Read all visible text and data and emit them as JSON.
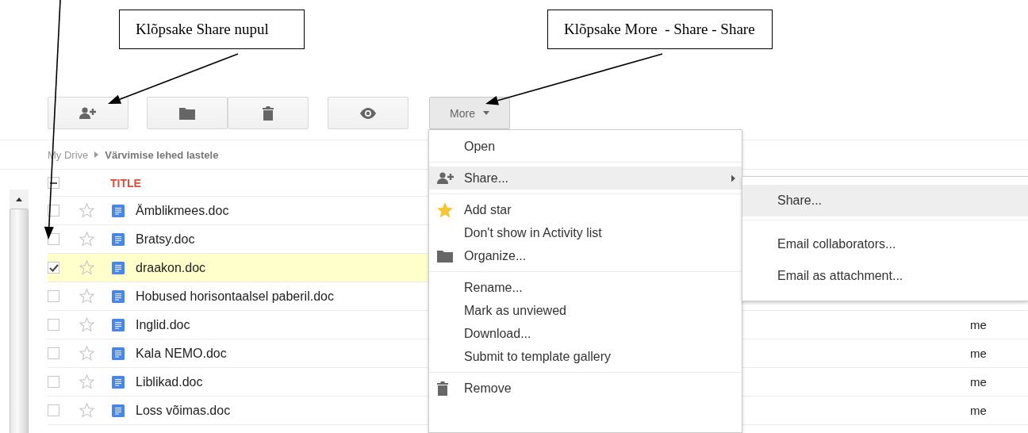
{
  "annotations": [
    {
      "text": "Klõpsake Share nupul"
    },
    {
      "text": "Klõpsake More  - Share - Share"
    }
  ],
  "toolbar": {
    "buttons": [
      {
        "kind": "share"
      },
      {
        "kind": "folder"
      },
      {
        "kind": "trash"
      },
      {
        "kind": "preview"
      },
      {
        "kind": "more",
        "label": "More"
      }
    ]
  },
  "breadcrumb": [
    "My Drive",
    "Värvimise lehed lastele"
  ],
  "table": {
    "select_all": {
      "indeterminate": true
    },
    "columns": [
      "TITLE"
    ],
    "rows": [
      {
        "name": "Ämblikmees.doc",
        "checked": false,
        "starred": false,
        "selected": false
      },
      {
        "name": "Bratsy.doc",
        "checked": false,
        "starred": false,
        "selected": false
      },
      {
        "name": "draakon.doc",
        "checked": true,
        "starred": false,
        "selected": true
      },
      {
        "name": "Hobused horisontaalsel paberil.doc",
        "checked": false,
        "starred": false,
        "selected": false
      },
      {
        "name": "Inglid.doc",
        "checked": false,
        "starred": false,
        "selected": false,
        "owner": "me"
      },
      {
        "name": "Kala NEMO.doc",
        "checked": false,
        "starred": false,
        "selected": false,
        "owner": "me"
      },
      {
        "name": "Liblikad.doc",
        "checked": false,
        "starred": false,
        "selected": false,
        "owner": "me"
      },
      {
        "name": "Loss võimas.doc",
        "checked": false,
        "starred": false,
        "selected": false,
        "owner": "me"
      }
    ]
  },
  "menu": {
    "items": [
      {
        "kind": "item",
        "label": "Open",
        "selected": false
      },
      {
        "kind": "separator"
      },
      {
        "kind": "share",
        "label": "Share...",
        "selected": true,
        "submenu": true
      },
      {
        "kind": "separator"
      },
      {
        "kind": "star",
        "label": "Add star",
        "selected": false
      },
      {
        "kind": "item",
        "label": "Don't show in Activity list",
        "selected": false
      },
      {
        "kind": "folder",
        "label": "Organize...",
        "selected": false
      },
      {
        "kind": "separator"
      },
      {
        "kind": "item",
        "label": "Rename...",
        "selected": false
      },
      {
        "kind": "item",
        "label": "Mark as unviewed",
        "selected": false
      },
      {
        "kind": "item",
        "label": "Download...",
        "selected": false
      },
      {
        "kind": "item",
        "label": "Submit to template gallery",
        "selected": false
      },
      {
        "kind": "separator"
      },
      {
        "kind": "trash",
        "label": "Remove",
        "selected": false
      }
    ]
  },
  "submenu": {
    "items": [
      {
        "kind": "item",
        "label": "Share...",
        "selected": true
      },
      {
        "kind": "separator"
      },
      {
        "kind": "item",
        "label": "Email collaborators...",
        "selected": false
      },
      {
        "kind": "item",
        "label": "Email as attachment...",
        "selected": false
      }
    ]
  }
}
